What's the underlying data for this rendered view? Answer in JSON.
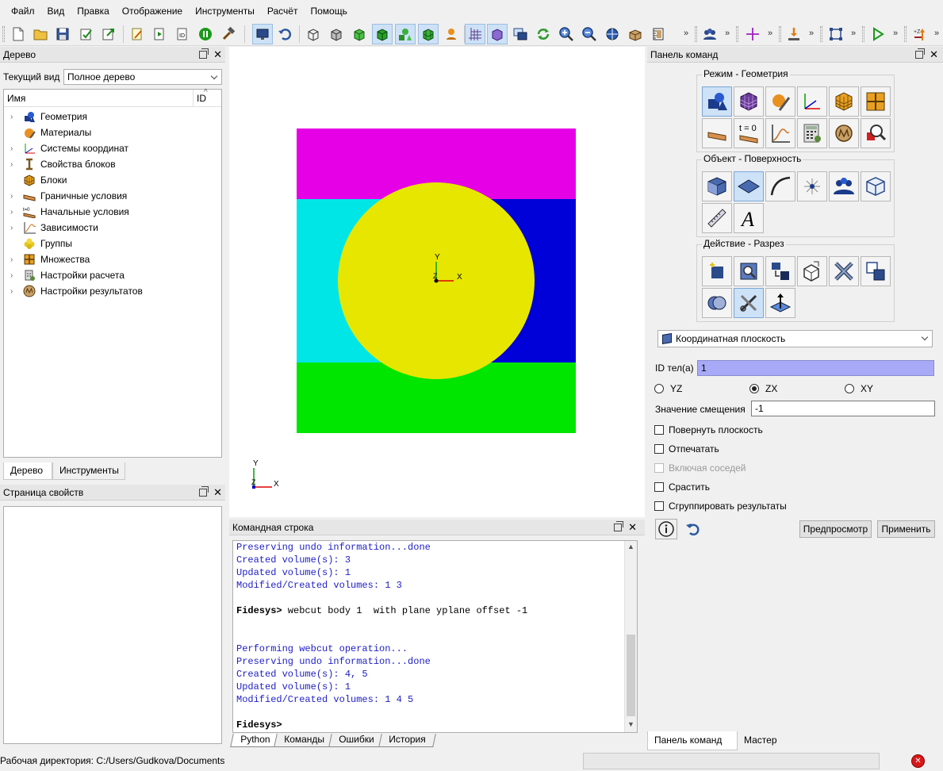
{
  "menu": [
    "Файл",
    "Вид",
    "Правка",
    "Отображение",
    "Инструменты",
    "Расчёт",
    "Помощь"
  ],
  "toolbar_icons": [
    "new-file-icon",
    "open-folder-icon",
    "save-icon",
    "save-check-icon",
    "export-icon",
    "edit-script-icon",
    "run-script-icon",
    "id-icon",
    "pause-icon",
    "hammer-icon",
    "screen-icon",
    "undo-icon",
    "wireframe-cube-icon",
    "hidden-line-cube-icon",
    "shaded-cube-icon",
    "green-cube-icon",
    "green-shapes-icon",
    "mesh-cube-icon",
    "person-icon",
    "axes-grid-icon",
    "purple-cube-icon",
    "windows-icon",
    "refresh-icon",
    "zoom-in-icon",
    "zoom-out-icon",
    "globe-icon",
    "box-icon",
    "ruler-icon",
    "group-icon",
    "crosshair-icon",
    "import-icon",
    "select-box-icon",
    "play-icon",
    "axis-z-icon"
  ],
  "tree_panel": {
    "title": "Дерево",
    "view_label": "Текущий вид",
    "view_value": "Полное дерево",
    "col_name": "Имя",
    "col_id": "ID",
    "items": [
      {
        "label": "Геометрия",
        "icon": "geometry-icon",
        "expandable": true
      },
      {
        "label": "Материалы",
        "icon": "materials-icon",
        "expandable": false
      },
      {
        "label": "Системы координат",
        "icon": "coordinate-system-icon",
        "expandable": true
      },
      {
        "label": "Свойства блоков",
        "icon": "block-properties-icon",
        "expandable": true
      },
      {
        "label": "Блоки",
        "icon": "blocks-icon",
        "expandable": false
      },
      {
        "label": "Граничные условия",
        "icon": "boundary-conditions-icon",
        "expandable": true
      },
      {
        "label": "Начальные условия",
        "icon": "initial-conditions-icon",
        "expandable": true
      },
      {
        "label": "Зависимости",
        "icon": "dependencies-icon",
        "expandable": true
      },
      {
        "label": "Группы",
        "icon": "groups-icon",
        "expandable": false
      },
      {
        "label": "Множества",
        "icon": "sets-icon",
        "expandable": true
      },
      {
        "label": "Настройки расчета",
        "icon": "calc-settings-icon",
        "expandable": true
      },
      {
        "label": "Настройки результатов",
        "icon": "results-settings-icon",
        "expandable": true
      }
    ],
    "tabs": [
      "Дерево",
      "Инструменты"
    ]
  },
  "property_panel": {
    "title": "Страница свойств"
  },
  "viewport": {
    "colors": {
      "magenta": "#e600e6",
      "cyan": "#00e6e6",
      "blue": "#0000d8",
      "green": "#00e600",
      "yellow": "#e6e600"
    },
    "axis_x": "X",
    "axis_y": "Y",
    "axis_z": "Z"
  },
  "command_line": {
    "title": "Командная строка",
    "lines": [
      {
        "type": "out",
        "text": "Preserving undo information...done"
      },
      {
        "type": "out",
        "text": "Created volume(s): 3"
      },
      {
        "type": "out",
        "text": "Updated volume(s): 1"
      },
      {
        "type": "out",
        "text": "Modified/Created volumes: 1 3"
      },
      {
        "type": "blank",
        "text": ""
      },
      {
        "type": "inp",
        "prompt": "Fidesys>",
        "text": " webcut body 1  with plane yplane offset -1"
      },
      {
        "type": "blank",
        "text": ""
      },
      {
        "type": "blank",
        "text": ""
      },
      {
        "type": "out",
        "text": "Performing webcut operation..."
      },
      {
        "type": "out",
        "text": "Preserving undo information...done"
      },
      {
        "type": "out",
        "text": "Created volume(s): 4, 5"
      },
      {
        "type": "out",
        "text": "Updated volume(s): 1"
      },
      {
        "type": "out",
        "text": "Modified/Created volumes: 1 4 5"
      },
      {
        "type": "blank",
        "text": ""
      },
      {
        "type": "inp",
        "prompt": "Fidesys>",
        "text": ""
      }
    ],
    "tabs": [
      "Python",
      "Команды",
      "Ошибки",
      "История"
    ]
  },
  "command_panel": {
    "title": "Панель команд",
    "group_mode": "Режим - Геометрия",
    "group_object": "Объект - Поверхность",
    "group_action": "Действие - Разрез",
    "mode_time_label": "t = 0",
    "font_label": "A",
    "method_value": "Координатная плоскость",
    "body_id_label": "ID тел(а)",
    "body_id_value": "1",
    "radio_yz": "YZ",
    "radio_zx": "ZX",
    "radio_xy": "XY",
    "offset_label": "Значение смещения",
    "offset_value": "-1",
    "check_rotate": "Повернуть плоскость",
    "check_imprint": "Отпечатать",
    "check_neighbors": "Включая соседей",
    "check_merge": "Срастить",
    "check_group": "Сгруппировать результаты",
    "btn_preview": "Предпросмотр",
    "btn_apply": "Применить",
    "tabs": [
      "Панель команд",
      "Мастер"
    ]
  },
  "status_bar": {
    "text": "Рабочая директория: C:/Users/Gudkova/Documents"
  }
}
